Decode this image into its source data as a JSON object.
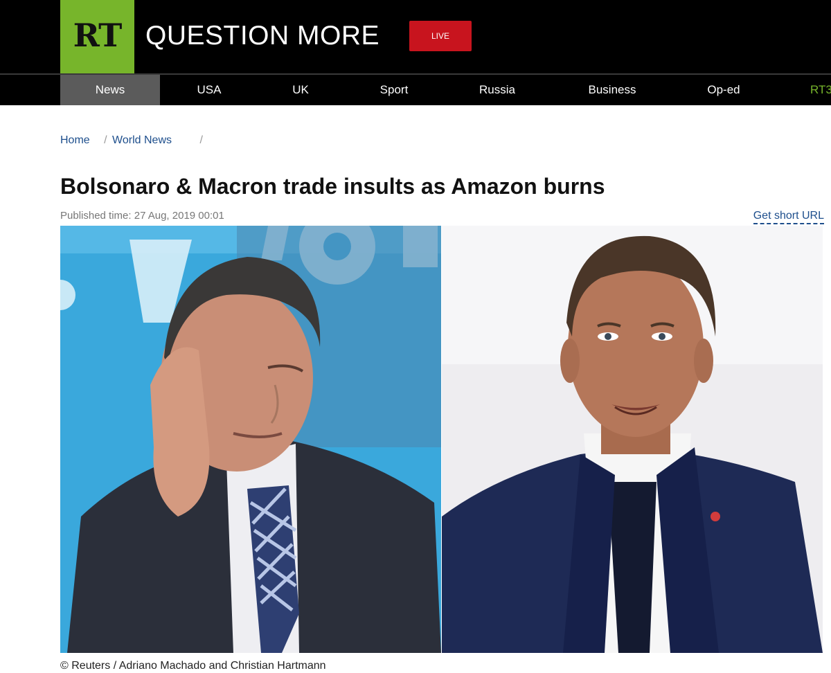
{
  "header": {
    "logo": "RT",
    "tagline": "QUESTION MORE",
    "live_label": "LIVE"
  },
  "nav": {
    "items": [
      "News",
      "USA",
      "UK",
      "Sport",
      "Russia",
      "Business",
      "Op-ed",
      "RT3"
    ],
    "active": "News"
  },
  "breadcrumb": {
    "home": "Home",
    "sep1": "/",
    "section": "World News",
    "sep2": "/"
  },
  "article": {
    "title": "Bolsonaro & Macron trade insults as Amazon burns",
    "published": "Published time: 27 Aug, 2019 00:01",
    "short_url_label": "Get short URL",
    "photo_credit": "© Reuters / Adriano Machado and Christian Hartmann"
  },
  "colors": {
    "brand_green": "#77b52b",
    "live_red": "#c8141e",
    "link_blue": "#1d4e8c",
    "left_photo_background": "#3aa8dc",
    "right_photo_background": "#eeedf0"
  }
}
